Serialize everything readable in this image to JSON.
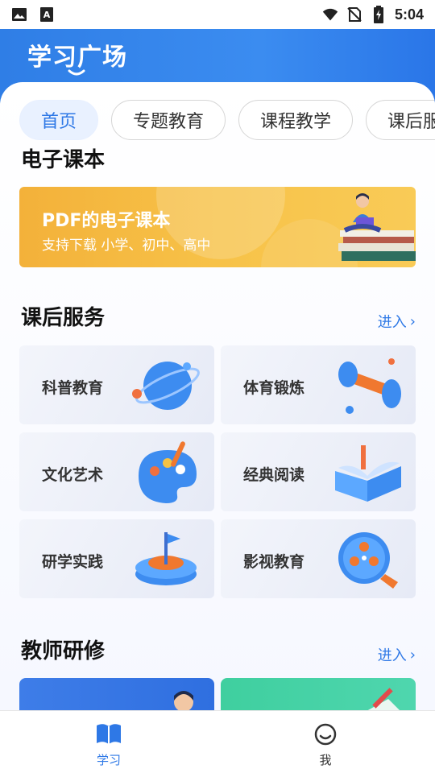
{
  "status_bar": {
    "time": "5:04",
    "icons": [
      "image-icon",
      "text-icon",
      "wifi-icon",
      "no-sim-icon",
      "battery-charging-icon"
    ]
  },
  "header": {
    "title": "学习广场"
  },
  "tabs": [
    {
      "label": "首页",
      "active": true
    },
    {
      "label": "专题教育",
      "active": false
    },
    {
      "label": "课程教学",
      "active": false
    },
    {
      "label": "课后服务",
      "active": false
    }
  ],
  "ebook": {
    "section_title": "电子课本",
    "banner_title": "PDF的电子课本",
    "banner_subtitle": "支持下载 小学、初中、高中"
  },
  "after_school": {
    "section_title": "课后服务",
    "enter_label": "进入",
    "items": [
      {
        "label": "科普教育",
        "icon": "planet-icon"
      },
      {
        "label": "体育锻炼",
        "icon": "dumbbell-icon"
      },
      {
        "label": "文化艺术",
        "icon": "palette-icon"
      },
      {
        "label": "经典阅读",
        "icon": "book-icon"
      },
      {
        "label": "研学实践",
        "icon": "flag-platform-icon"
      },
      {
        "label": "影视教育",
        "icon": "film-reel-icon"
      }
    ]
  },
  "teacher": {
    "section_title": "教师研修",
    "enter_label": "进入"
  },
  "bottom_nav": {
    "items": [
      {
        "label": "学习",
        "icon": "book-open-icon",
        "active": true
      },
      {
        "label": "我",
        "icon": "smile-face-icon",
        "active": false
      }
    ]
  },
  "colors": {
    "brand_blue": "#2e78e6",
    "banner_orange": "#f5b83f"
  }
}
